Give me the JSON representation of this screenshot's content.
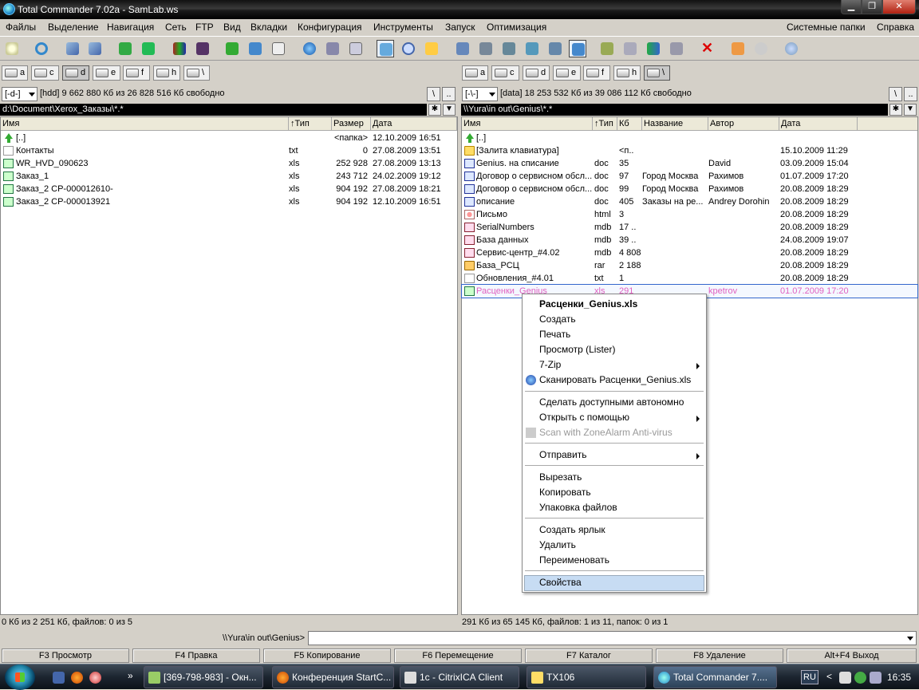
{
  "window": {
    "title": "Total Commander 7.02a - SamLab.ws"
  },
  "menubar": {
    "items": [
      "Файлы",
      "Выделение",
      "Навигация",
      "Сеть",
      "FTP",
      "Вид",
      "Вкладки",
      "Конфигурация",
      "Инструменты",
      "Запуск",
      "Оптимизация"
    ],
    "right": [
      "Системные папки",
      "Справка"
    ]
  },
  "left": {
    "drives": [
      "a",
      "c",
      "d",
      "e",
      "f",
      "h",
      "\\"
    ],
    "selected_drive": "d",
    "drive_combo": "[-d-]",
    "free": "[hdd]  9 662 880 Кб из 26 828 516 Кб свободно",
    "path": "d:\\Document\\Xerox_Заказы\\*.*",
    "columns": [
      "Имя",
      "↑Тип",
      "Размер",
      "Дата"
    ],
    "rows": [
      {
        "name": "[..]",
        "ext": "",
        "size": "<папка>",
        "date": "12.10.2009 16:51",
        "icon": "up-icon"
      },
      {
        "name": "Контакты",
        "ext": "txt",
        "size": "0",
        "date": "27.08.2009 13:51",
        "icon": "txt-file-icon"
      },
      {
        "name": "WR_HVD_090623",
        "ext": "xls",
        "size": "252 928",
        "date": "27.08.2009 13:13",
        "icon": "excel-file-icon"
      },
      {
        "name": "Заказ_1",
        "ext": "xls",
        "size": "243 712",
        "date": "24.02.2009 19:12",
        "icon": "excel-file-icon"
      },
      {
        "name": "Заказ_2 СР-000012610-",
        "ext": "xls",
        "size": "904 192",
        "date": "27.08.2009 18:21",
        "icon": "excel-file-icon"
      },
      {
        "name": "Заказ_2 СР-000013921",
        "ext": "xls",
        "size": "904 192",
        "date": "12.10.2009 16:51",
        "icon": "excel-file-icon"
      }
    ],
    "status": "0 Кб из 2 251 Кб, файлов: 0 из 5"
  },
  "right": {
    "drives": [
      "a",
      "c",
      "d",
      "e",
      "f",
      "h",
      "\\"
    ],
    "selected_drive": "\\",
    "drive_combo": "[-\\-]",
    "free": "[data]  18 253 532 Кб из 39 086 112 Кб свободно",
    "path": "\\\\Yura\\in out\\Genius\\*.*",
    "columns": [
      "Имя",
      "↑Тип",
      "Кб",
      "Название",
      "Автор",
      "Дата"
    ],
    "rows": [
      {
        "name": "[..]",
        "ext": "",
        "kb": "",
        "title": "",
        "author": "",
        "date": "",
        "icon": "up-icon"
      },
      {
        "name": "[Залита клавиатура]",
        "ext": "",
        "kb": "<п..",
        "title": "",
        "author": "",
        "date": "15.10.2009 11:29",
        "icon": "folder-icon"
      },
      {
        "name": "Genius. на списание",
        "ext": "doc",
        "kb": "35",
        "title": "",
        "author": "David",
        "date": "03.09.2009 15:04",
        "icon": "word-file-icon"
      },
      {
        "name": "Договор о сервисном обсл...",
        "ext": "doc",
        "kb": "97",
        "title": "Город Москва",
        "author": "Рахимов",
        "date": "01.07.2009 17:20",
        "icon": "word-file-icon"
      },
      {
        "name": "Договор о сервисном обсл...",
        "ext": "doc",
        "kb": "99",
        "title": "Город Москва",
        "author": "Рахимов",
        "date": "20.08.2009 18:29",
        "icon": "word-file-icon"
      },
      {
        "name": "описание",
        "ext": "doc",
        "kb": "405",
        "title": "Заказы на ре...",
        "author": "Andrey Dorohin",
        "date": "20.08.2009 18:29",
        "icon": "word-file-icon"
      },
      {
        "name": "Письмо",
        "ext": "html",
        "kb": "3",
        "title": "",
        "author": "",
        "date": "20.08.2009 18:29",
        "icon": "html-file-icon"
      },
      {
        "name": "SerialNumbers",
        "ext": "mdb",
        "kb": "17 ..",
        "title": "",
        "author": "",
        "date": "20.08.2009 18:29",
        "icon": "access-file-icon"
      },
      {
        "name": "База данных",
        "ext": "mdb",
        "kb": "39 ..",
        "title": "",
        "author": "",
        "date": "24.08.2009 19:07",
        "icon": "access-file-icon"
      },
      {
        "name": "Сервис-центр_#4.02",
        "ext": "mdb",
        "kb": "4 808",
        "title": "",
        "author": "",
        "date": "20.08.2009 18:29",
        "icon": "access-file-icon"
      },
      {
        "name": "База_РСЦ",
        "ext": "rar",
        "kb": "2 188",
        "title": "",
        "author": "",
        "date": "20.08.2009 18:29",
        "icon": "rar-archive-icon"
      },
      {
        "name": "Обновления_#4.01",
        "ext": "txt",
        "kb": "1",
        "title": "",
        "author": "",
        "date": "20.08.2009 18:29",
        "icon": "txt-file-icon"
      },
      {
        "name": "Расценки_Genius",
        "ext": "xls",
        "kb": "291",
        "title": "",
        "author": "kpetrov",
        "date": "01.07.2009 17:20",
        "icon": "excel-file-icon"
      }
    ],
    "status": "291 Кб из 65 145 Кб, файлов: 1 из 11, папок: 0 из 1"
  },
  "cmdline": {
    "prompt": "\\\\Yura\\in out\\Genius>",
    "value": ""
  },
  "fkeys": [
    "F3 Просмотр",
    "F4 Правка",
    "F5 Копирование",
    "F6 Перемещение",
    "F7 Каталог",
    "F8 Удаление",
    "Alt+F4 Выход"
  ],
  "context_menu": {
    "header": "Расценки_Genius.xls",
    "items": [
      "Создать",
      "Печать",
      "Просмотр (Lister)",
      "7-Zip",
      "Сканировать Расценки_Genius.xls",
      "Сделать доступными автономно",
      "Открыть с помощью",
      "Scan with ZoneAlarm Anti-virus",
      "Отправить",
      "Вырезать",
      "Копировать",
      "Упаковка файлов",
      "Создать ярлык",
      "Удалить",
      "Переименовать",
      "Свойства"
    ]
  },
  "taskbar": {
    "tasks": [
      "[369-798-983] - Окн...",
      "Конференция StartC...",
      "1c - CitrixICA Client",
      "TX106",
      "Total Commander 7...."
    ],
    "lang": "RU",
    "clock": "16:35"
  }
}
